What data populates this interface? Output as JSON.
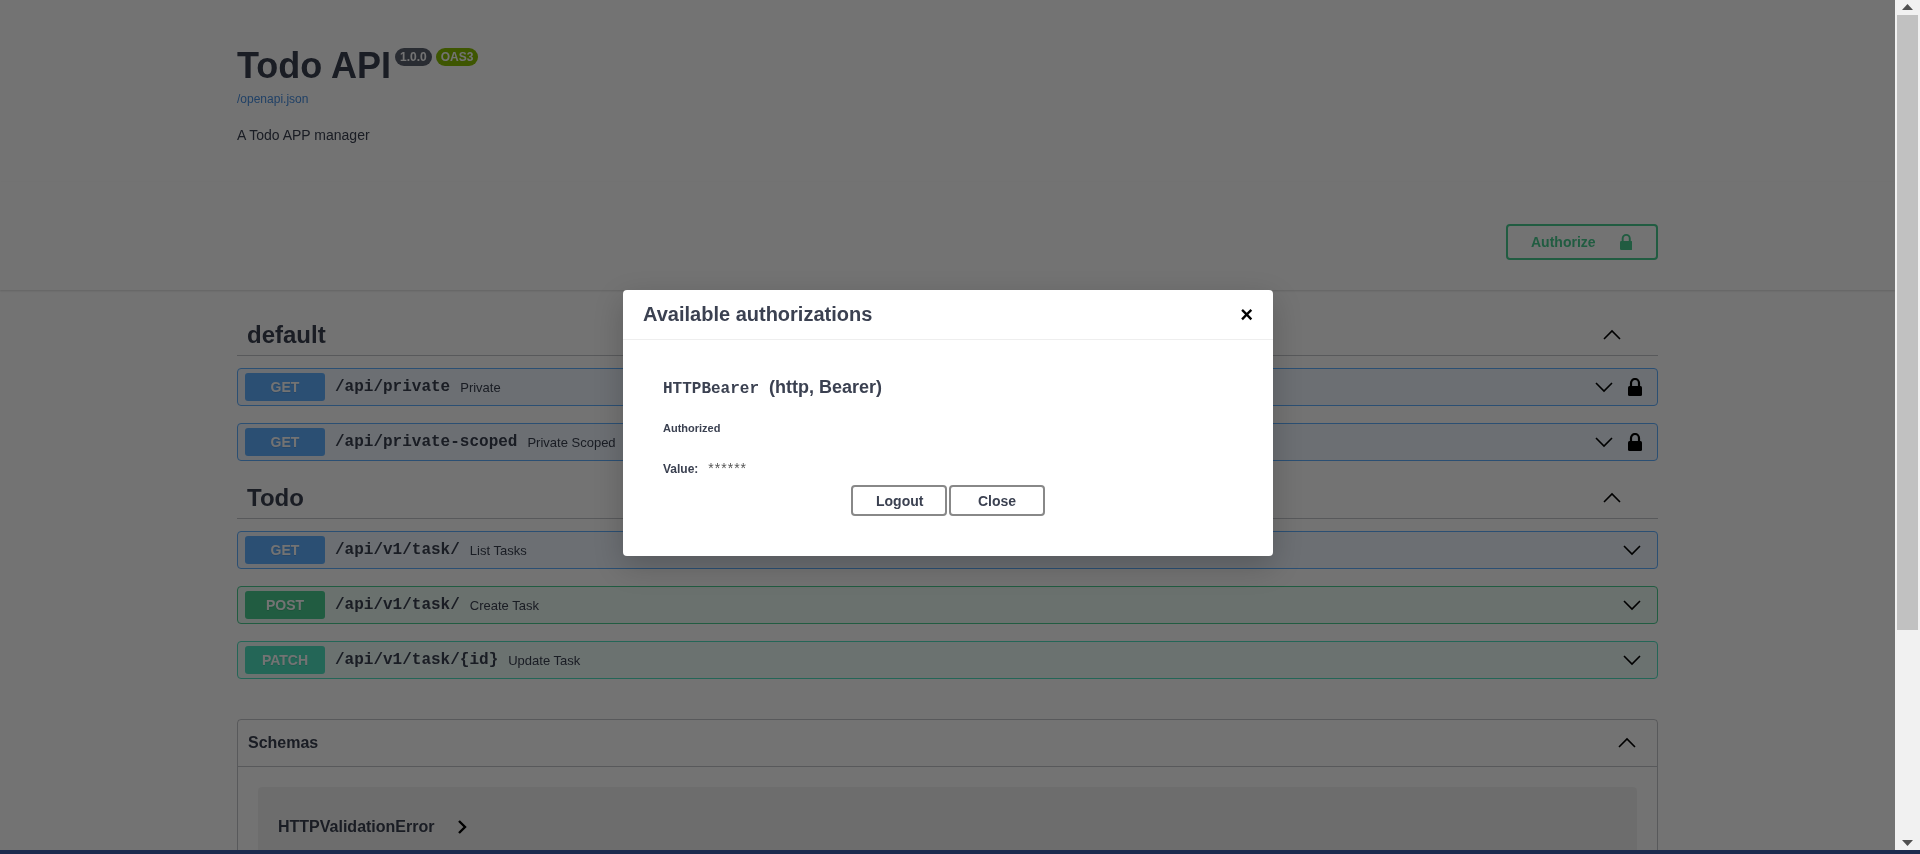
{
  "info": {
    "title": "Todo API",
    "version": "1.0.0",
    "spec": "OAS3",
    "link": "/openapi.json",
    "description": "A Todo APP manager"
  },
  "authorize_button": {
    "label": "Authorize"
  },
  "sections": [
    {
      "name": "default",
      "expanded": true,
      "operations": [
        {
          "method": "GET",
          "path": "/api/private",
          "summary": "Private",
          "locked": true
        },
        {
          "method": "GET",
          "path": "/api/private-scoped",
          "summary": "Private Scoped",
          "locked": true
        }
      ]
    },
    {
      "name": "Todo",
      "expanded": true,
      "operations": [
        {
          "method": "GET",
          "path": "/api/v1/task/",
          "summary": "List Tasks",
          "locked": false
        },
        {
          "method": "POST",
          "path": "/api/v1/task/",
          "summary": "Create Task",
          "locked": false
        },
        {
          "method": "PATCH",
          "path": "/api/v1/task/{id}",
          "summary": "Update Task",
          "locked": false
        }
      ]
    }
  ],
  "schemas": {
    "title": "Schemas",
    "expanded": true,
    "items": [
      {
        "name": "HTTPValidationError",
        "expanded": false
      }
    ]
  },
  "modal": {
    "title": "Available authorizations",
    "close": "×",
    "scheme_name": "HTTPBearer",
    "scheme_type": "(http, Bearer)",
    "status": "Authorized",
    "value_label": "Value:",
    "value": "******",
    "buttons": [
      "Logout",
      "Close"
    ]
  }
}
